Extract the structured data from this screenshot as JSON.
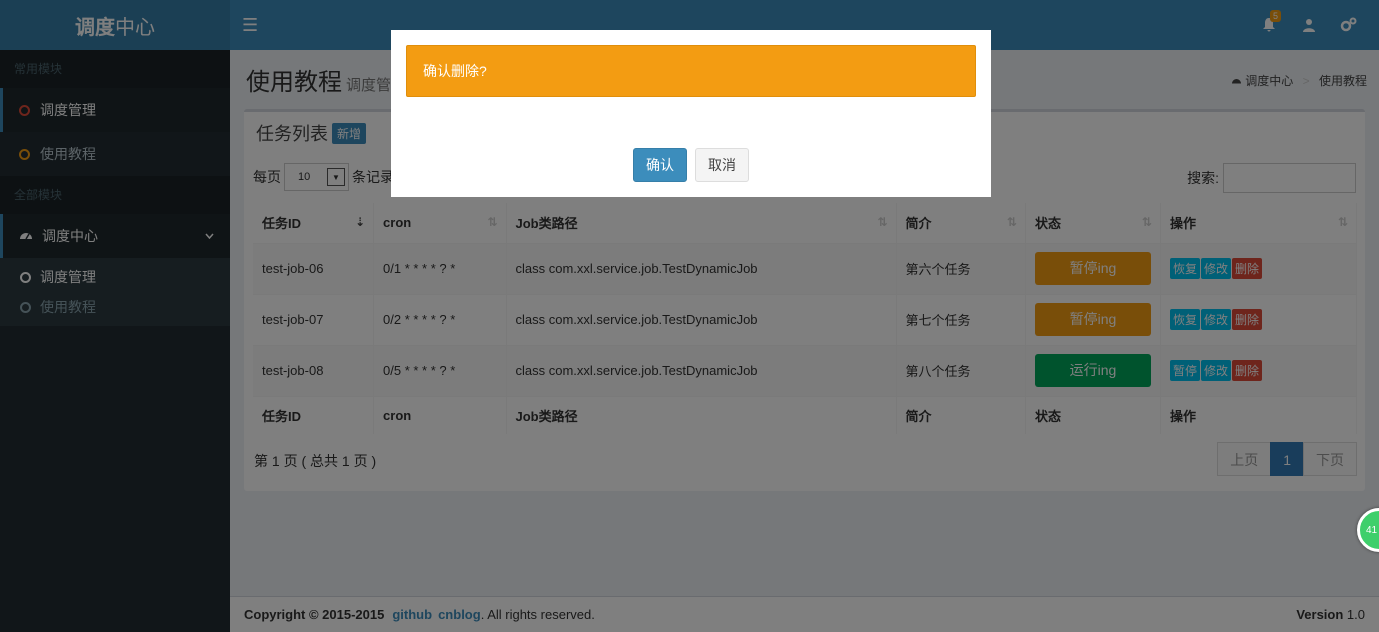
{
  "app": {
    "logo_bold": "调度",
    "logo_rest": "中心"
  },
  "header": {
    "menu_icon": "☰",
    "notif_count": "5"
  },
  "sidebar": {
    "section1": "常用模块",
    "common_items": [
      {
        "label": "调度管理"
      },
      {
        "label": "使用教程"
      }
    ],
    "section2": "全部模块",
    "group_label": "调度中心",
    "sub_items": [
      {
        "label": "调度管理"
      },
      {
        "label": "使用教程"
      }
    ]
  },
  "page": {
    "title": "使用教程",
    "subtitle": "调度管",
    "breadcrumb_home": "调度中心",
    "breadcrumb_current": "使用教程"
  },
  "panel": {
    "title": "任务列表",
    "new_btn": "新增",
    "per_page_prefix": "每页",
    "per_page_value": "10",
    "per_page_suffix": "条记录",
    "search_label": "搜索:"
  },
  "table": {
    "headers": [
      "任务ID",
      "cron",
      "Job类路径",
      "简介",
      "状态",
      "操作"
    ],
    "rows": [
      {
        "id": "test-job-06",
        "cron": "0/1 * * * * ? *",
        "path": "class com.xxl.service.job.TestDynamicJob",
        "desc": "第六个任务",
        "status": "暂停ing",
        "status_color": "#f39c12",
        "op1": "恢复",
        "op2": "修改",
        "op3": "删除"
      },
      {
        "id": "test-job-07",
        "cron": "0/2 * * * * ? *",
        "path": "class com.xxl.service.job.TestDynamicJob",
        "desc": "第七个任务",
        "status": "暂停ing",
        "status_color": "#f39c12",
        "op1": "恢复",
        "op2": "修改",
        "op3": "删除"
      },
      {
        "id": "test-job-08",
        "cron": "0/5 * * * * ? *",
        "path": "class com.xxl.service.job.TestDynamicJob",
        "desc": "第八个任务",
        "status": "运行ing",
        "status_color": "#00a65a",
        "op1": "暂停",
        "op2": "修改",
        "op3": "删除"
      }
    ],
    "info": "第 1 页 ( 总共 1 页 )",
    "prev": "上页",
    "page": "1",
    "next": "下页"
  },
  "footer": {
    "copyright": "Copyright © 2015-2015",
    "link1": "github",
    "link2": "cnblog",
    "rights": ". All rights reserved.",
    "version_label": "Version",
    "version": "1.0"
  },
  "modal": {
    "message": "确认删除?",
    "ok": "确认",
    "cancel": "取消"
  },
  "float_ball": {
    "value": "41"
  }
}
